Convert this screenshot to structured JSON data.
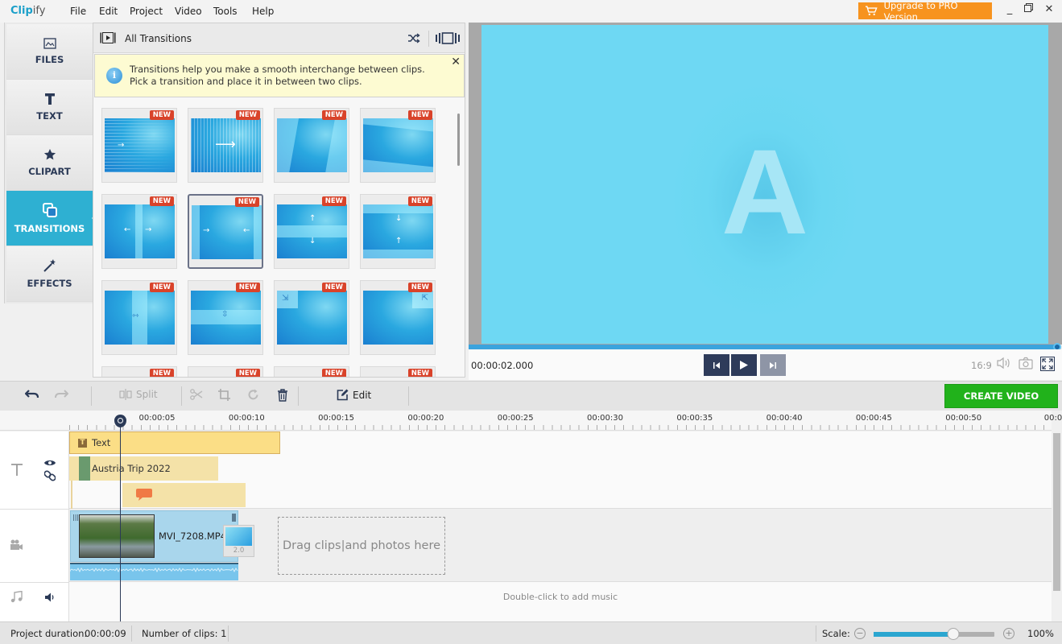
{
  "app": {
    "name_bold": "Clip",
    "name_light": "ify",
    "menu": [
      "File",
      "Edit",
      "Project",
      "Video",
      "Tools",
      "Help"
    ],
    "upgrade_label": "Upgrade to PRO Version",
    "accent": "#2eb0d2",
    "upgrade_color": "#f7931e",
    "create_color": "#21b21b"
  },
  "sidebar": {
    "items": [
      {
        "label": "FILES",
        "icon": "image-icon"
      },
      {
        "label": "TEXT",
        "icon": "text-t-icon"
      },
      {
        "label": "CLIPART",
        "icon": "star-icon"
      },
      {
        "label": "TRANSITIONS",
        "icon": "transitions-icon",
        "active": true
      },
      {
        "label": "EFFECTS",
        "icon": "magic-wand-icon"
      }
    ]
  },
  "panel": {
    "title": "All Transitions",
    "info_text": "Transitions help you make a smooth interchange between clips. Pick a transition and place it in between two clips.",
    "badge": "NEW",
    "tiles": [
      {
        "badge": "NEW",
        "style": "blinds-horizontal"
      },
      {
        "badge": "NEW",
        "style": "blinds-vertical"
      },
      {
        "badge": "NEW",
        "style": "diagonal-wipe"
      },
      {
        "badge": "NEW",
        "style": "skew-wipe"
      },
      {
        "badge": "NEW",
        "style": "split-vertical-out"
      },
      {
        "badge": "NEW",
        "style": "split-vertical-in",
        "selected": true
      },
      {
        "badge": "NEW",
        "style": "split-horizontal-out"
      },
      {
        "badge": "NEW",
        "style": "split-horizontal-in"
      },
      {
        "badge": "NEW",
        "style": "box-vertical"
      },
      {
        "badge": "NEW",
        "style": "box-horizontal"
      },
      {
        "badge": "NEW",
        "style": "corner-top-left"
      },
      {
        "badge": "NEW",
        "style": "corner-top-right"
      },
      {
        "badge": "NEW",
        "style": "partial"
      },
      {
        "badge": "NEW",
        "style": "partial"
      },
      {
        "badge": "NEW",
        "style": "partial"
      },
      {
        "badge": "NEW",
        "style": "partial"
      }
    ]
  },
  "preview": {
    "letter": "A",
    "timecode": "00:00:02.000",
    "aspect": "16:9",
    "progress_fraction": 1.0
  },
  "toolbar": {
    "split_label": "Split",
    "edit_label": "Edit",
    "create_label": "CREATE VIDEO"
  },
  "timeline": {
    "ticks": [
      "00:00:05",
      "00:00:10",
      "00:00:15",
      "00:00:20",
      "00:00:25",
      "00:00:30",
      "00:00:35",
      "00:00:40",
      "00:00:45",
      "00:00:50",
      "00:0"
    ],
    "text_clip_label": "Text",
    "title_clip_label": "Austria  Trip 2022",
    "video_clip_name": "MVI_7208.MP4",
    "transition_duration": "2.0",
    "dropzone_text": "Drag clips|and photos here",
    "music_hint": "Double-click to add music"
  },
  "status": {
    "duration_label": "Project duration:",
    "duration_value": "00:00:09",
    "clips_label": "Number of clips: 1",
    "scale_label": "Scale:",
    "scale_value": "100%",
    "scale_fraction": 0.66
  }
}
